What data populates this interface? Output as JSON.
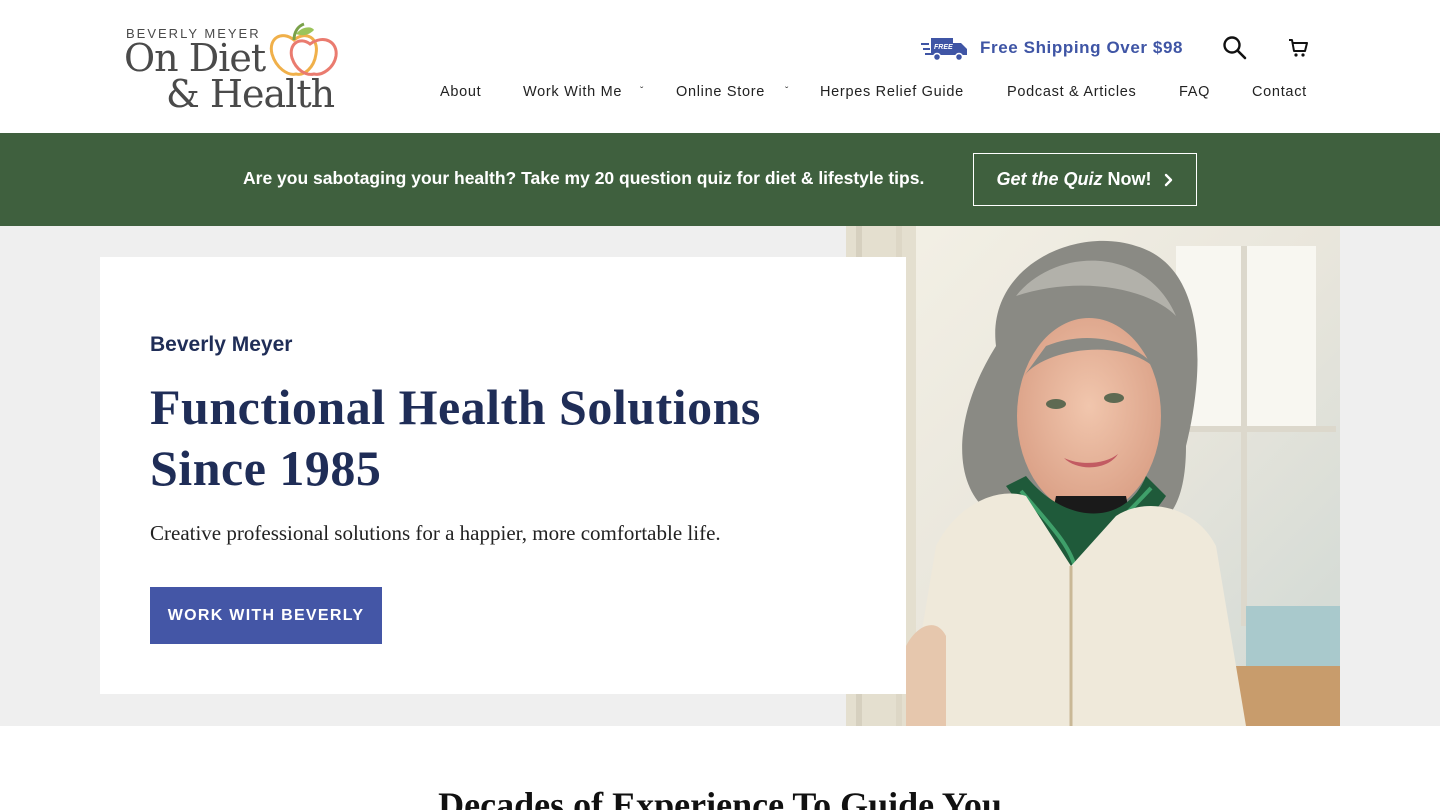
{
  "logo": {
    "top": "BEVERLY MEYER",
    "line2": "On Diet",
    "line3": "& Health"
  },
  "header": {
    "shipping_text": "Free Shipping Over $98",
    "shipping_badge": "FREE"
  },
  "nav": {
    "items": [
      {
        "label": "About"
      },
      {
        "label": "Work With Me"
      },
      {
        "label": "Online Store"
      },
      {
        "label": "Herpes Relief Guide"
      },
      {
        "label": "Podcast & Articles"
      },
      {
        "label": "FAQ"
      },
      {
        "label": "Contact"
      }
    ],
    "chevron": "ˇ"
  },
  "banner": {
    "text": "Are you sabotaging your health? Take my 20 question quiz for diet & lifestyle tips.",
    "button_em": "Get the Quiz",
    "button_now": "Now!"
  },
  "hero": {
    "name": "Beverly Meyer",
    "title": "Functional Health Solutions Since 1985",
    "subtitle": "Creative professional solutions for a happier, more comfortable life.",
    "cta": "WORK WITH BEVERLY"
  },
  "section": {
    "heading": "Decades of Experience To Guide You"
  },
  "colors": {
    "banner_green": "#3f603e",
    "brand_blue": "#3f55a5",
    "navy": "#1f2d57",
    "cta_blue": "#4456a6"
  }
}
